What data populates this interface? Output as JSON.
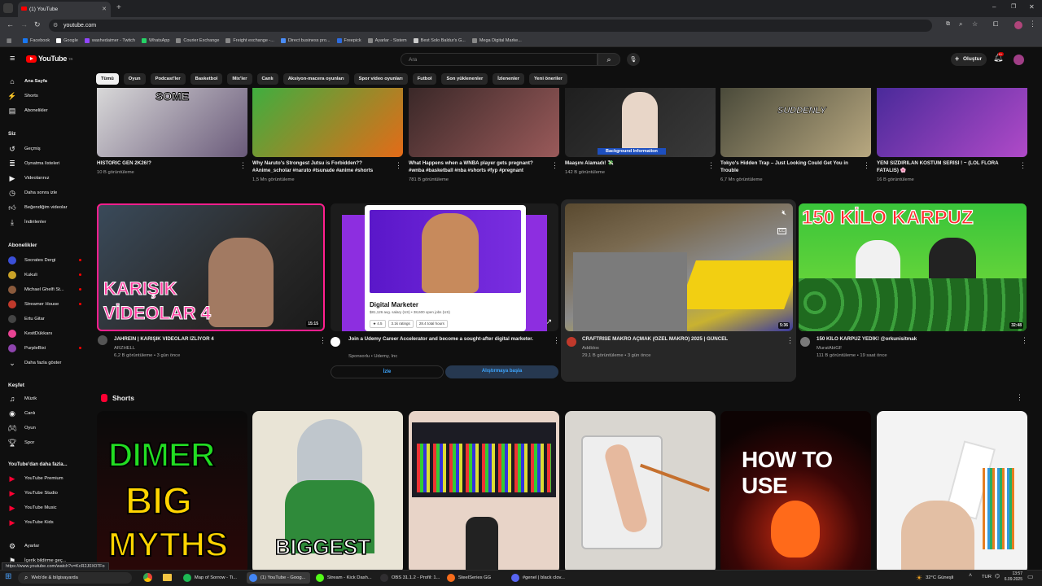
{
  "browser": {
    "tab_title": "(1) YouTube",
    "url": "youtube.com",
    "bookmarks": [
      "Facebook",
      "Google",
      "washedaimer - Twitch",
      "WhatsApp",
      "Courier Exchange",
      "Freight exchange -...",
      "Direct business pro...",
      "Freepick",
      "Ayarlar - Sistem",
      "Best Solo Baldur's G...",
      "Mega Digital Marke..."
    ],
    "status_url": "https://www.youtube.com/watch?v=KcR2J0X07Fo"
  },
  "header": {
    "logo": "YouTube",
    "logo_region": "TR",
    "search_placeholder": "Ara",
    "create_label": "Oluştur",
    "notif_count": "9+"
  },
  "chips": [
    "Tümü",
    "Oyun",
    "Podcast'ler",
    "Basketbol",
    "Mix'ler",
    "Canlı",
    "Aksiyon-macera oyunları",
    "Spor video oyunları",
    "Futbol",
    "Son yüklenenler",
    "İzlenenler",
    "Yeni öneriler"
  ],
  "sidebar": {
    "main": [
      "Ana Sayfa",
      "Shorts",
      "Abonelikler"
    ],
    "you_header": "Siz",
    "you": [
      "Geçmiş",
      "Oynatma listeleri",
      "Videolarınız",
      "Daha sonra izle",
      "Beğendiğim videolar",
      "İndirilenler"
    ],
    "subs_header": "Abonelikler",
    "subs": [
      {
        "name": "Socrates Dergi",
        "color": "#3b4fd8"
      },
      {
        "name": "Kukuli",
        "color": "#c9a227"
      },
      {
        "name": "Michael Ghelfi St...",
        "color": "#8a5a3c"
      },
      {
        "name": "Streamer House",
        "color": "#c0392b"
      },
      {
        "name": "Ertu Gitar",
        "color": "#444444"
      },
      {
        "name": "KesitDükkanı",
        "color": "#e84393"
      },
      {
        "name": "PurpleBixi",
        "color": "#8e44ad"
      }
    ],
    "show_more": "Daha fazla göster",
    "explore_header": "Keşfet",
    "explore": [
      "Müzik",
      "Canlı",
      "Oyun",
      "Spor"
    ],
    "more_header": "YouTube'dan daha fazla...",
    "more": [
      "YouTube Premium",
      "YouTube Studio",
      "YouTube Music",
      "YouTube Kids"
    ],
    "settings": "Ayarlar",
    "feedback": "İçerik bildirme geç..."
  },
  "row1": [
    {
      "title": "HISTORIC GEN 2K26!?",
      "meta": "10 B görüntüleme"
    },
    {
      "title": "Why Naruto's Strongest Jutsu is Forbidden?? #Anime_scholar #naruto #tsunade #anime #shorts",
      "meta": "1,5 Mn görüntüleme"
    },
    {
      "title": "What Happens when a WNBA player gets pregnant? #wnba #basketball #nba #shorts #fyp #pregnant",
      "meta": "781 B görüntüleme"
    },
    {
      "title": "Maaşını Alamadı! 💸",
      "meta": "142 B görüntüleme"
    },
    {
      "title": "Tokyo's Hidden Trap – Just Looking Could Get You in Trouble",
      "meta": "6,7 Mn görüntüleme"
    },
    {
      "title": "YENİ SIZDIRILAN KOSTÜM SERİSİ ! ~ (LOL FLORA FATALIS) 🌸",
      "meta": "16 B görüntüleme"
    }
  ],
  "row1_thumb_text": {
    "t1": "SOME",
    "t4": "Background Information",
    "t5": "SUDDENLY"
  },
  "row2": [
    {
      "title": "JAHREİN | KARIŞIK VİDEOLAR İZLİYOR 4",
      "channel": "ARZHELL",
      "meta": "6,2 B görüntüleme • 3 gün önce",
      "duration": "15:15",
      "thumb_text": "KARIŞIK VİDEOLAR 4",
      "avatar": "#555"
    },
    {
      "title": "Join a Udemy Career Accelerator and become a sought-after digital marketer.",
      "channel": "Sponsorlu • Udemy, Inc",
      "ad_card_title": "Digital Marketer",
      "ad_card_meta": "$81,126 avg. salary (US) • 38,600 open jobs (US)",
      "ad_rating": "4.5",
      "ad_ratings": "3.1k ratings",
      "ad_hours": "28.4 total hours",
      "btn_watch": "İzle",
      "btn_start": "Alıştırmaya başla"
    },
    {
      "title": "CRAFTRİSE MAKRO AÇMAK (ÖZEL MAKRO) 2025 | GÜNCEL",
      "channel": "Addblox",
      "meta": "29,1 B görüntüleme • 3 gün önce",
      "duration": "5:36",
      "avatar": "#c0392b"
    },
    {
      "title": "150 KİLO KARPUZ YEDİK! @orkunisitmak",
      "channel": "MuratAbiGF",
      "meta": "111 B görüntüleme • 19 saat önce",
      "duration": "32:48",
      "thumb_text": "150 KİLO KARPUZ",
      "avatar": "#7a7a7a"
    }
  ],
  "shorts_header": "Shorts",
  "shorts_thumb_text": {
    "s1a": "DIMER",
    "s1b": "BIG",
    "s1c": "MYTHS",
    "s2": "BIGGEST",
    "s5": "HOW TO USE"
  },
  "taskbar": {
    "search": "Web'de & bilgisayarda",
    "apps": [
      "Map of Sorrow - Ti...",
      "(1) YouTube - Goog...",
      "Stream - Kick Dash...",
      "OBS 31.1.2 - Profil: 1...",
      "SteelSeries GG",
      "#genel | black clov..."
    ],
    "weather": "32°C Güneşli",
    "lang": "TUR",
    "time": "13:57",
    "date": "6.09.2025"
  }
}
